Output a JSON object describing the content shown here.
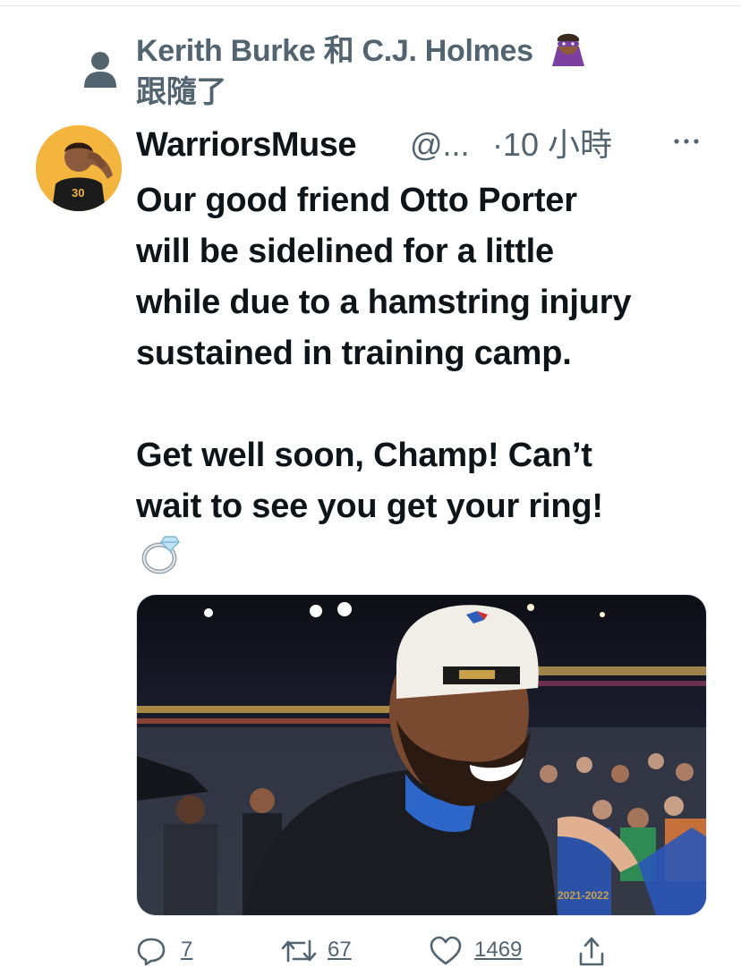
{
  "context": {
    "text": "Kerith Burke 和 C.J. Holmes",
    "followed_label": "跟隨了",
    "icon": "person-icon",
    "emoji": "superhero-emoji"
  },
  "tweet": {
    "author_name": "WarriorsMuse",
    "handle": "@...",
    "separator": "·",
    "time": "10 小時",
    "more_icon": "more-icon",
    "body": "Our good friend Otto Porter\nwill be sidelined for a little\nwhile due to a hamstring injury\nsustained in training camp.\n\nGet well soon, Champ! Can’t\nwait to see you get your ring!",
    "ring_emoji": "ring-emoji",
    "media": "photo-player-celebrating-in-arena"
  },
  "actions": {
    "reply_count": "7",
    "retweet_count": "67",
    "like_count": "1469",
    "share_icon": "share-icon"
  },
  "colors": {
    "text_primary": "#0f1419",
    "text_secondary": "#536471",
    "avatar_bg": "#f4b53f"
  }
}
